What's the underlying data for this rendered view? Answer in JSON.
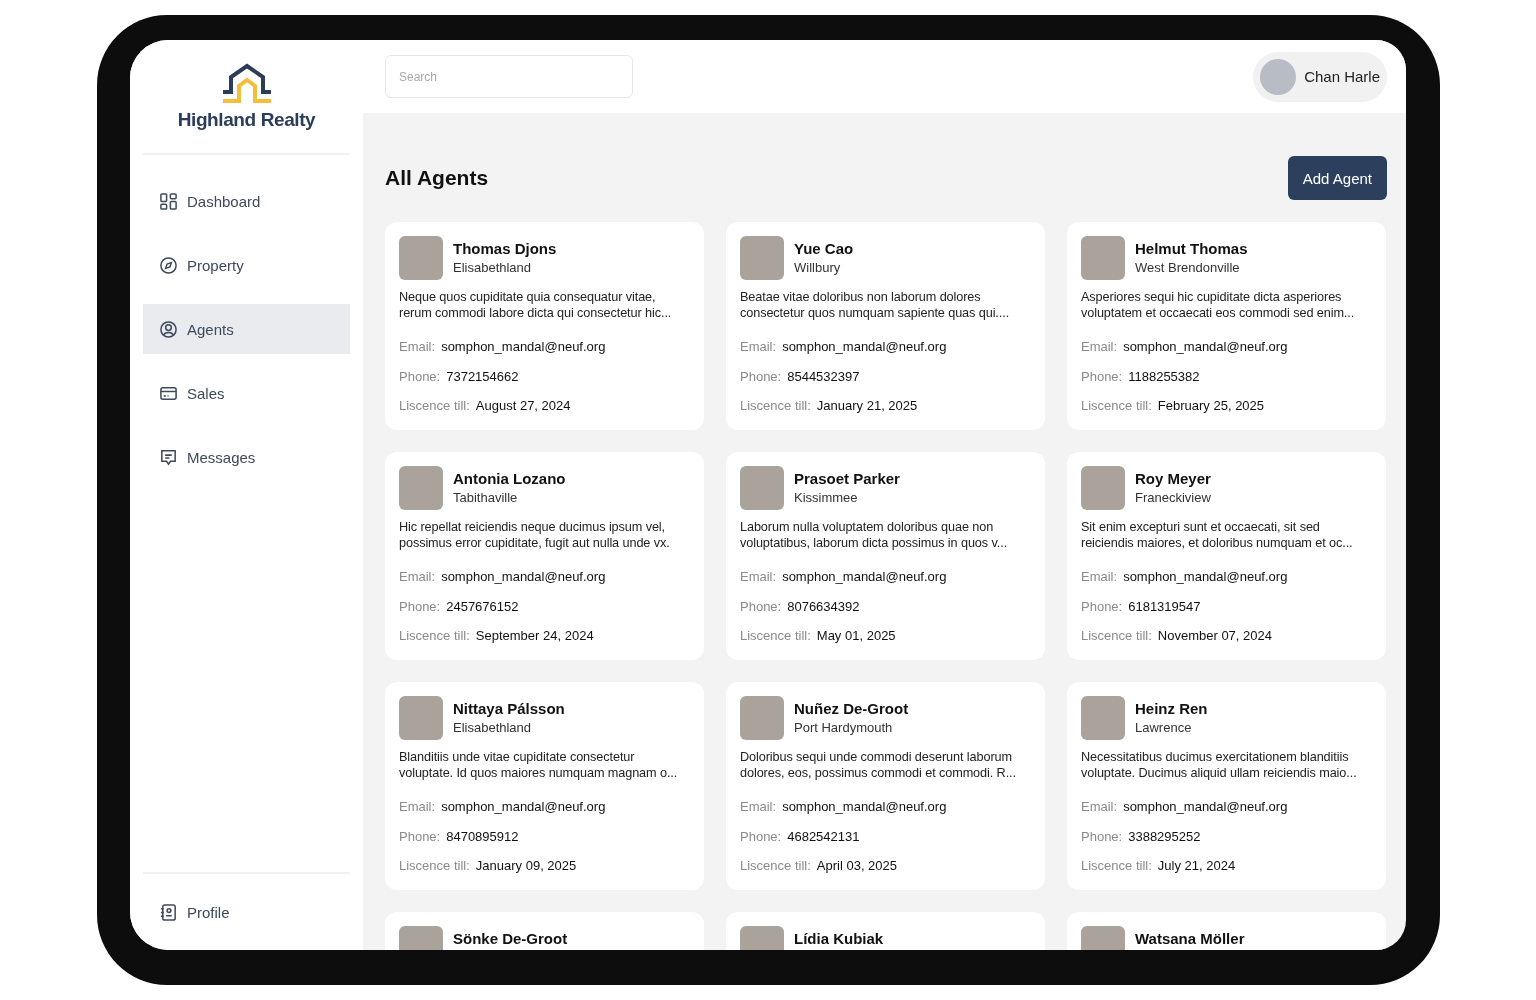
{
  "brand": {
    "name": "Highland Realty"
  },
  "sidebar": {
    "items": [
      {
        "label": "Dashboard",
        "selected": false
      },
      {
        "label": "Property",
        "selected": false
      },
      {
        "label": "Agents",
        "selected": true
      },
      {
        "label": "Sales",
        "selected": false
      },
      {
        "label": "Messages",
        "selected": false
      }
    ],
    "footer_items": [
      {
        "label": "Profile",
        "selected": false
      }
    ]
  },
  "header": {
    "search": {
      "placeholder": "Search"
    },
    "user": {
      "name": "Chan Harle"
    }
  },
  "page": {
    "title": "All Agents",
    "add_button": "Add Agent"
  },
  "agents": [
    {
      "name": "Thomas Djons",
      "location": "Elisabethland",
      "description": "Neque quos cupiditate quia consequatur vitae, rerum commodi labore dicta qui consectetur hic...",
      "email_label": "Email:",
      "email": "somphon_mandal@neuf.org",
      "phone_label": "Phone:",
      "phone": "7372154662",
      "licence_label": "Liscence till:",
      "licence_till": "August 27, 2024"
    },
    {
      "name": "Yue Cao",
      "location": "Willbury",
      "description": "Beatae vitae doloribus non laborum dolores consectetur quos numquam sapiente quas qui....",
      "email_label": "Email:",
      "email": "somphon_mandal@neuf.org",
      "phone_label": "Phone:",
      "phone": "8544532397",
      "licence_label": "Liscence till:",
      "licence_till": "January 21, 2025"
    },
    {
      "name": "Helmut Thomas",
      "location": "West Brendonville",
      "description": "Asperiores sequi hic cupiditate dicta asperiores voluptatem et occaecati eos commodi sed enim...",
      "email_label": "Email:",
      "email": "somphon_mandal@neuf.org",
      "phone_label": "Phone:",
      "phone": "1188255382",
      "licence_label": "Liscence till:",
      "licence_till": "February 25, 2025"
    },
    {
      "name": "Antonia Lozano",
      "location": "Tabithaville",
      "description": "Hic repellat reiciendis neque ducimus ipsum vel, possimus error cupiditate, fugit aut nulla unde vx.",
      "email_label": "Email:",
      "email": "somphon_mandal@neuf.org",
      "phone_label": "Phone:",
      "phone": "2457676152",
      "licence_label": "Liscence till:",
      "licence_till": "September 24, 2024"
    },
    {
      "name": "Prasoet Parker",
      "location": "Kissimmee",
      "description": "Laborum nulla voluptatem doloribus quae non voluptatibus, laborum dicta possimus in quos v...",
      "email_label": "Email:",
      "email": "somphon_mandal@neuf.org",
      "phone_label": "Phone:",
      "phone": "8076634392",
      "licence_label": "Liscence till:",
      "licence_till": "May 01, 2025"
    },
    {
      "name": "Roy Meyer",
      "location": "Franeckiview",
      "description": "Sit enim excepturi sunt et occaecati, sit sed reiciendis maiores, et doloribus numquam et oc...",
      "email_label": "Email:",
      "email": "somphon_mandal@neuf.org",
      "phone_label": "Phone:",
      "phone": "6181319547",
      "licence_label": "Liscence till:",
      "licence_till": "November 07, 2024"
    },
    {
      "name": "Nittaya Pálsson",
      "location": "Elisabethland",
      "description": "Blanditiis unde vitae cupiditate consectetur voluptate. Id quos maiores numquam magnam o...",
      "email_label": "Email:",
      "email": "somphon_mandal@neuf.org",
      "phone_label": "Phone:",
      "phone": "8470895912",
      "licence_label": "Liscence till:",
      "licence_till": "January 09, 2025"
    },
    {
      "name": "Nuñez De-Groot",
      "location": "Port Hardymouth",
      "description": "Doloribus sequi unde commodi deserunt laborum dolores, eos, possimus commodi et commodi. R...",
      "email_label": "Email:",
      "email": "somphon_mandal@neuf.org",
      "phone_label": "Phone:",
      "phone": "4682542131",
      "licence_label": "Liscence till:",
      "licence_till": "April 03, 2025"
    },
    {
      "name": "Heinz Ren",
      "location": "Lawrence",
      "description": "Necessitatibus ducimus exercitationem blanditiis voluptate. Ducimus aliquid ullam reiciendis maio...",
      "email_label": "Email:",
      "email": "somphon_mandal@neuf.org",
      "phone_label": "Phone:",
      "phone": "3388295252",
      "licence_label": "Liscence till:",
      "licence_till": "July 21, 2024"
    },
    {
      "name": "Sönke De-Groot"
    },
    {
      "name": "Lídia Kubiak"
    },
    {
      "name": "Watsana Möller"
    }
  ]
}
